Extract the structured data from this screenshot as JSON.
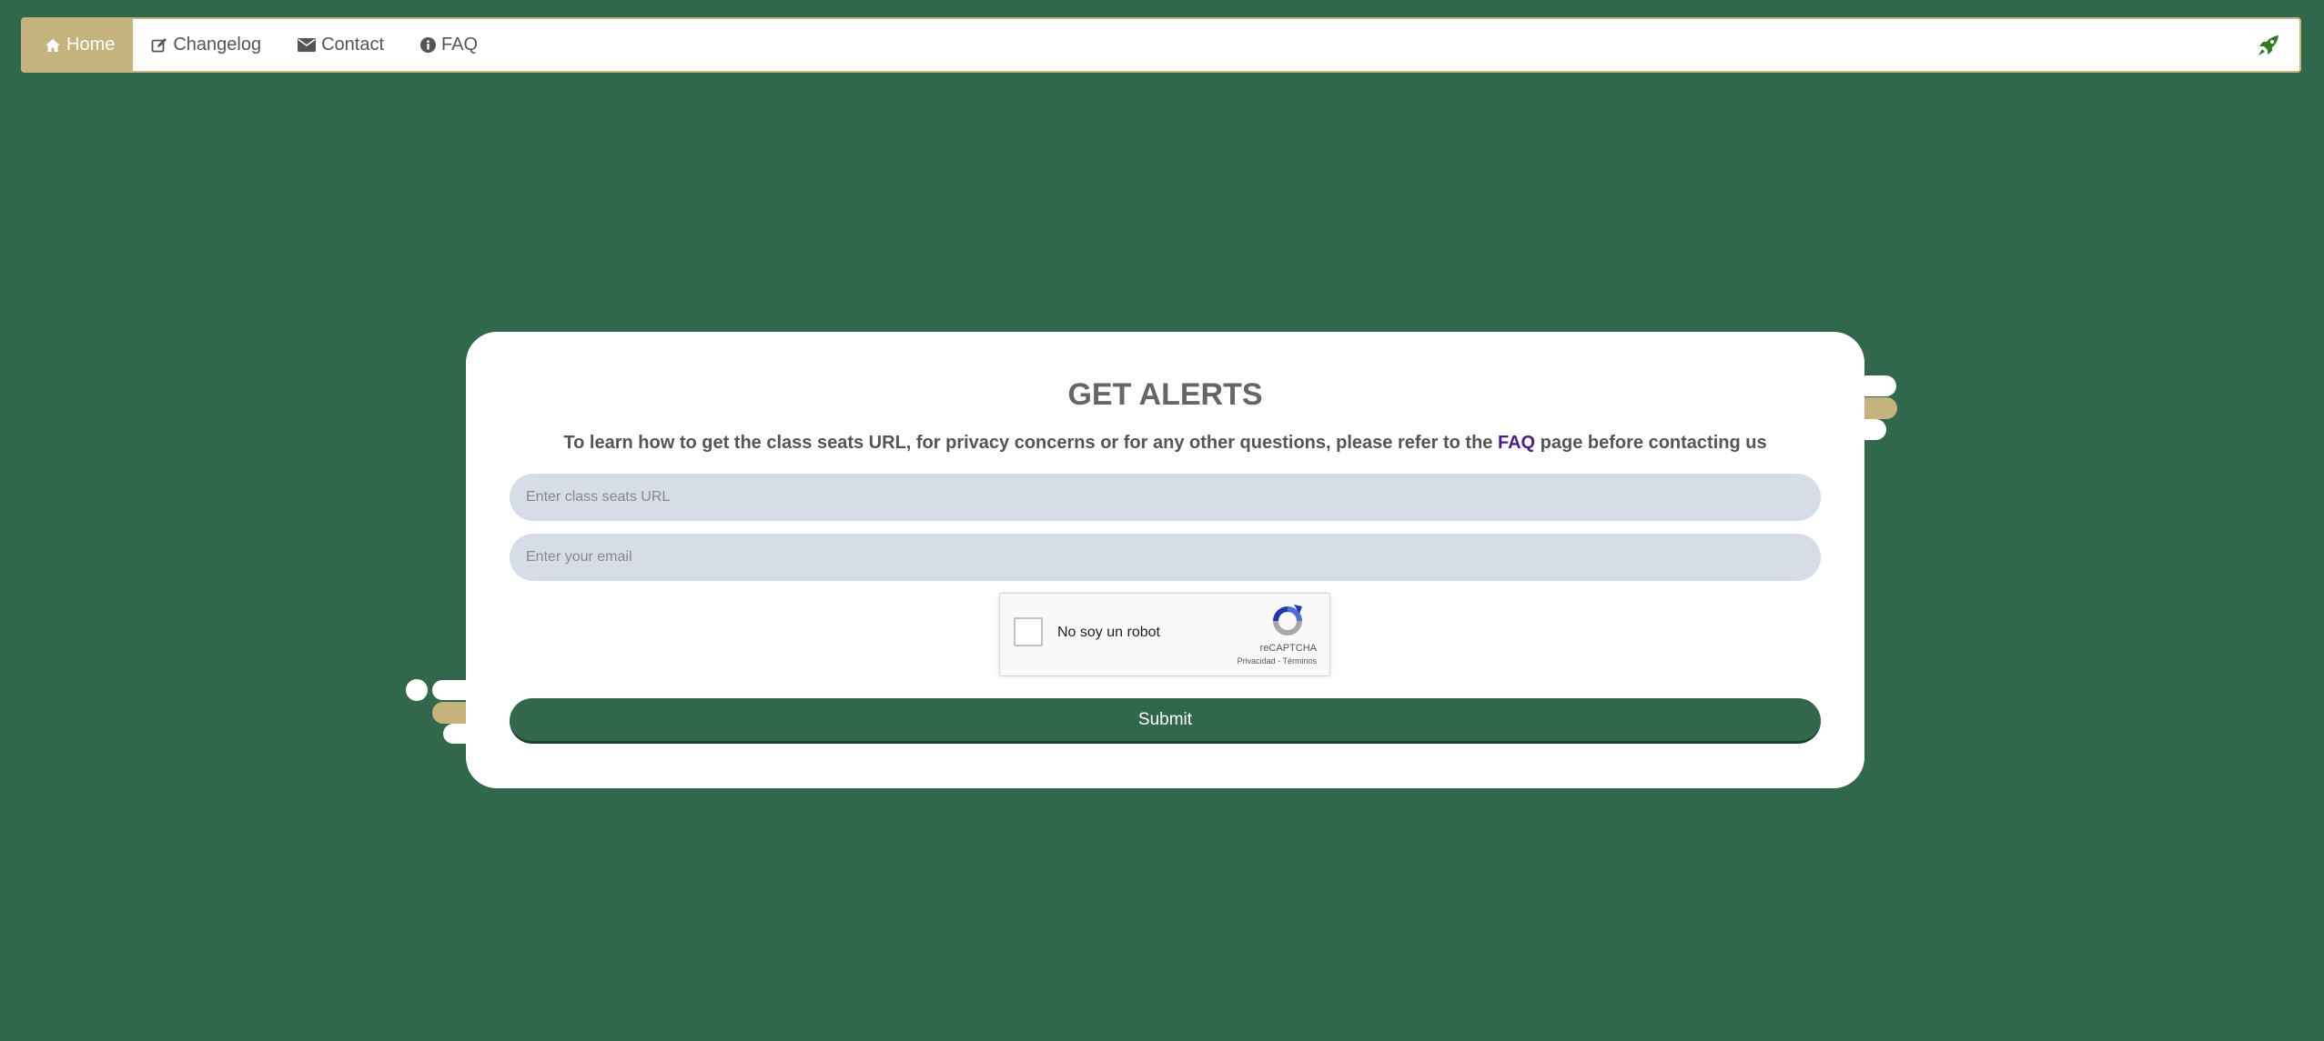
{
  "nav": {
    "items": [
      {
        "label": "Home",
        "icon": "home-icon",
        "active": true
      },
      {
        "label": "Changelog",
        "icon": "edit-icon",
        "active": false
      },
      {
        "label": "Contact",
        "icon": "envelope-icon",
        "active": false
      },
      {
        "label": "FAQ",
        "icon": "info-circle-icon",
        "active": false
      }
    ],
    "right_icon": "rocket-icon"
  },
  "form": {
    "title": "GET ALERTS",
    "info_before": "To learn how to get the class seats URL, for privacy concerns or for any other questions, please refer to the ",
    "info_link": "FAQ",
    "info_after": " page before contacting us",
    "url_placeholder": "Enter class seats URL",
    "url_value": "",
    "email_placeholder": "Enter your email",
    "email_value": "",
    "submit_label": "Submit"
  },
  "captcha": {
    "label": "No soy un robot",
    "brand": "reCAPTCHA",
    "privacy": "Privacidad",
    "separator": " - ",
    "terms": "Términos"
  },
  "colors": {
    "background": "#31674a",
    "accent": "#c5b37d",
    "link": "#4b1e8f",
    "input_bg": "#d6dde6"
  }
}
